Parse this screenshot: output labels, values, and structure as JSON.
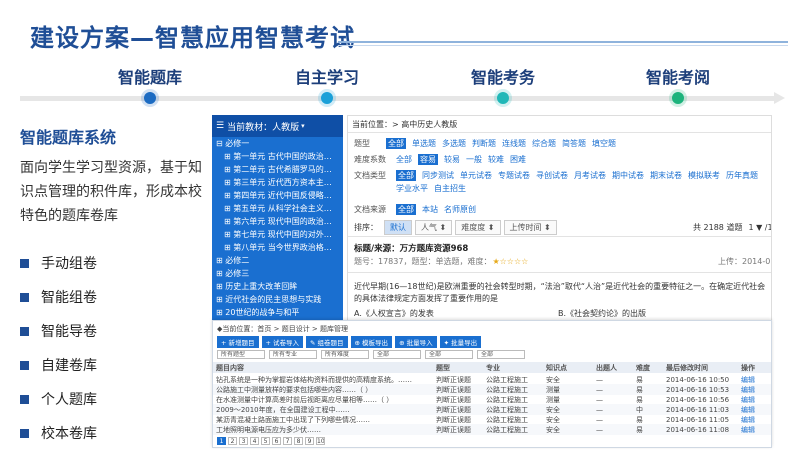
{
  "title": "建设方案—智慧应用智慧考试",
  "stages": [
    {
      "label": "智能题库",
      "color": "#1c6bc2"
    },
    {
      "label": "自主学习",
      "color": "#1aa0d8"
    },
    {
      "label": "智能考务",
      "color": "#20b8b8"
    },
    {
      "label": "智能考阅",
      "color": "#1db37c"
    }
  ],
  "system_title": "智能题库系统",
  "description": "面向学生学习型资源，基于知识点管理的积件库，形成本校特色的题库卷库",
  "features": [
    "手动组卷",
    "智能组卷",
    "智能导卷",
    "自建卷库",
    "个人题库",
    "校本卷库"
  ],
  "screenshot": {
    "sidebar": {
      "header": "当前教材：人教版",
      "items": [
        {
          "text": "⊟ 必修一",
          "level": 1
        },
        {
          "text": "⊞ 第一单元 古代中国的政治…",
          "level": 2
        },
        {
          "text": "⊞ 第二单元 古代希腊罗马的…",
          "level": 2
        },
        {
          "text": "⊞ 第三单元 近代西方资本主…",
          "level": 2
        },
        {
          "text": "⊞ 第四单元 近代中国反侵略…",
          "level": 2
        },
        {
          "text": "⊞ 第五单元 从科学社会主义…",
          "level": 2
        },
        {
          "text": "⊞ 第六单元 现代中国的政治…",
          "level": 2
        },
        {
          "text": "⊞ 第七单元 现代中国的对外…",
          "level": 2
        },
        {
          "text": "⊞ 第八单元 当今世界政治格…",
          "level": 2
        },
        {
          "text": "⊞ 必修二",
          "level": 1
        },
        {
          "text": "⊞ 必修三",
          "level": 1
        },
        {
          "text": "⊞ 历史上重大改革回眸",
          "level": 1
        },
        {
          "text": "⊞ 近代社会的民主思想与实践",
          "level": 1
        },
        {
          "text": "⊞ 20世纪的战争与和平",
          "level": 1
        },
        {
          "text": "⊞ 中外历史人物评说",
          "level": 1
        }
      ]
    },
    "question_panel": {
      "location": "当前位置：> 高中历史人教版",
      "type_label": "题型",
      "types": [
        "全部",
        "单选题",
        "多选题",
        "判断题",
        "连线题",
        "综合题",
        "简答题",
        "填空题"
      ],
      "difficulty_label": "难度系数",
      "difficulties": [
        "全部",
        "容易",
        "较易",
        "一般",
        "较难",
        "困难"
      ],
      "doctype_label": "文档类型",
      "doctypes": [
        "全部",
        "同步测试",
        "单元试卷",
        "专题试卷",
        "寻创试卷",
        "月考试卷",
        "期中试卷",
        "期末试卷",
        "模拟联考",
        "历年真题",
        "学业水平",
        "自主招生"
      ],
      "source_label": "文档来源",
      "sources": [
        "全部",
        "本站",
        "名师原创"
      ],
      "sort_label": "排序：",
      "sorts": [
        "默认",
        "人气 ⬍",
        "难度度 ⬍",
        "上传时间 ⬍"
      ],
      "count": "共 2188 道题",
      "pager": "1 ▼ /1",
      "item_title": "标题/来源：万方题库资源968",
      "item_meta": "题号：17837，题型：单选题，难度：",
      "item_date": "上传：2014-07",
      "item_stars": "★☆☆☆☆",
      "question_text": "近代早期(16—18世纪)是欧洲重要的社会转型时期，“法治”取代“人治”是近代社会的重要特征之一。在确定近代社会的具体法律规定方面发挥了重要作用的是",
      "option_a": "A.《人权宣言》的发表",
      "option_b": "B.《社会契约论》的出版"
    },
    "table_panel": {
      "breadcrumb": "◆当前位置：首页 > 题目设计 > 题库管理",
      "buttons": [
        "+ 新增题目",
        "+ 试卷导入",
        "✎ 组卷题目",
        "⊕ 模板导出",
        "⊕ 批量导入",
        "✦ 批量导出"
      ],
      "filters": [
        "所有题型",
        "所有专业",
        "所有难度",
        "全部",
        "全部",
        "全部"
      ],
      "headers": [
        "题目内容",
        "",
        "题型",
        "专业",
        "知识点",
        "出题人",
        "难度",
        "最后修改时间",
        "操作"
      ],
      "rows": [
        [
          "钻孔系统是一种为掌握岩体结构资料而提供的高精度系统。……",
          "判断正误题",
          "公路工程施工",
          "安全",
          "—",
          "易",
          "2014-06-16 10:50",
          "编辑"
        ],
        [
          "公路施工中测量放样的要求包括哪些内容……（ ）",
          "判断正误题",
          "公路工程施工",
          "测量",
          "—",
          "易",
          "2014-06-16 10:53",
          "编辑"
        ],
        [
          "在水准测量中计算高差时前后视距离应尽量相等……（ ）",
          "判断正误题",
          "公路工程施工",
          "测量",
          "—",
          "易",
          "2014-06-16 10:56",
          "编辑"
        ],
        [
          "2009～2010年度，在全国建设工程中……",
          "判断正误题",
          "公路工程施工",
          "安全",
          "—",
          "中",
          "2014-06-16 11:03",
          "编辑"
        ],
        [
          "某沥青混凝土路面施工中出现了下列哪些情况……",
          "判断正误题",
          "公路工程施工",
          "安全",
          "—",
          "易",
          "2014-06-16 11:05",
          "编辑"
        ],
        [
          "工地照明电源电压应为多少伏……",
          "判断正误题",
          "公路工程施工",
          "安全",
          "—",
          "易",
          "2014-06-16 11:08",
          "编辑"
        ]
      ],
      "pages": [
        "1",
        "2",
        "3",
        "4",
        "5",
        "6",
        "7",
        "8",
        "9",
        "10"
      ]
    }
  }
}
